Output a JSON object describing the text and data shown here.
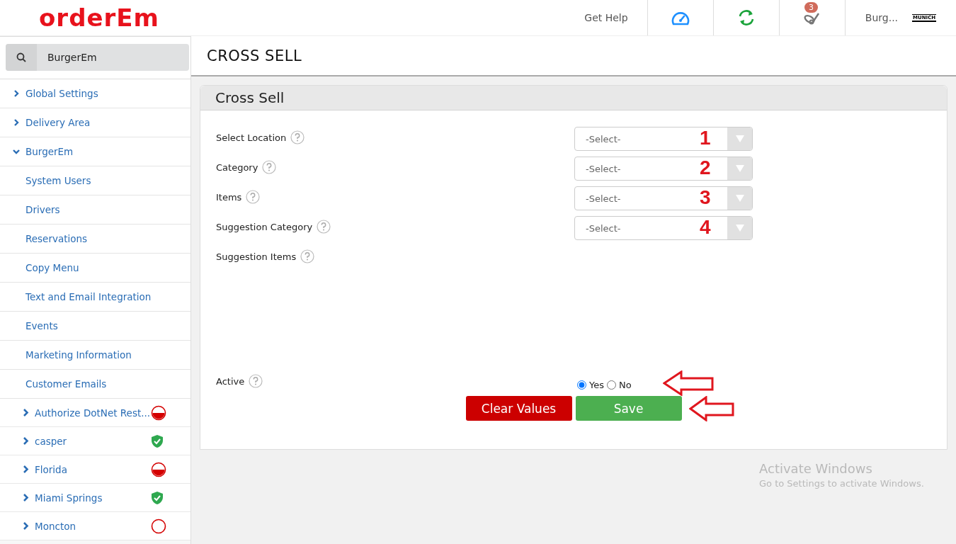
{
  "header": {
    "logo": "orderEm",
    "help_link": "Get Help",
    "notification_count": "3",
    "account_name": "Burg...",
    "brand_logo": "MUNICH"
  },
  "sidebar": {
    "search": {
      "value": "BurgerEm"
    },
    "items": [
      {
        "label": "Global Settings",
        "expanded": false
      },
      {
        "label": "Delivery Area",
        "expanded": false
      },
      {
        "label": "BurgerEm",
        "expanded": true,
        "children": [
          {
            "label": "System Users"
          },
          {
            "label": "Drivers"
          },
          {
            "label": "Reservations"
          },
          {
            "label": "Copy Menu"
          },
          {
            "label": "Text and Email Integration"
          },
          {
            "label": "Events"
          },
          {
            "label": "Marketing Information"
          },
          {
            "label": "Customer Emails"
          }
        ]
      }
    ],
    "locations": [
      {
        "label": "Authorize DotNet Rest...",
        "kind": "closed"
      },
      {
        "label": "casper",
        "kind": "verified"
      },
      {
        "label": "Florida",
        "kind": "closed"
      },
      {
        "label": "Miami Springs",
        "kind": "verified"
      },
      {
        "label": "Moncton",
        "kind": "off"
      }
    ]
  },
  "page_title": "CROSS SELL",
  "panel": {
    "title": "Cross Sell",
    "fields": [
      {
        "label": "Select Location",
        "kind": "select",
        "value": "-Select-",
        "annotation": "1"
      },
      {
        "label": "Category",
        "kind": "select",
        "value": "-Select-",
        "annotation": "2"
      },
      {
        "label": "Items",
        "kind": "select",
        "value": "-Select-",
        "annotation": "3"
      },
      {
        "label": "Suggestion Category",
        "kind": "select",
        "value": "-Select-",
        "annotation": "4"
      },
      {
        "label": "Suggestion Items",
        "kind": "list"
      },
      {
        "label": "Active",
        "kind": "radio",
        "arrow": true,
        "options": [
          {
            "label": "Yes",
            "selected": true
          },
          {
            "label": "No",
            "selected": false
          }
        ]
      }
    ],
    "buttons": [
      {
        "label": "Clear Values",
        "kind": "clear",
        "arrow": false
      },
      {
        "label": "Save",
        "kind": "save",
        "arrow": true
      }
    ]
  },
  "watermark": {
    "title": "Activate Windows",
    "text": "Go to Settings to activate Windows."
  }
}
